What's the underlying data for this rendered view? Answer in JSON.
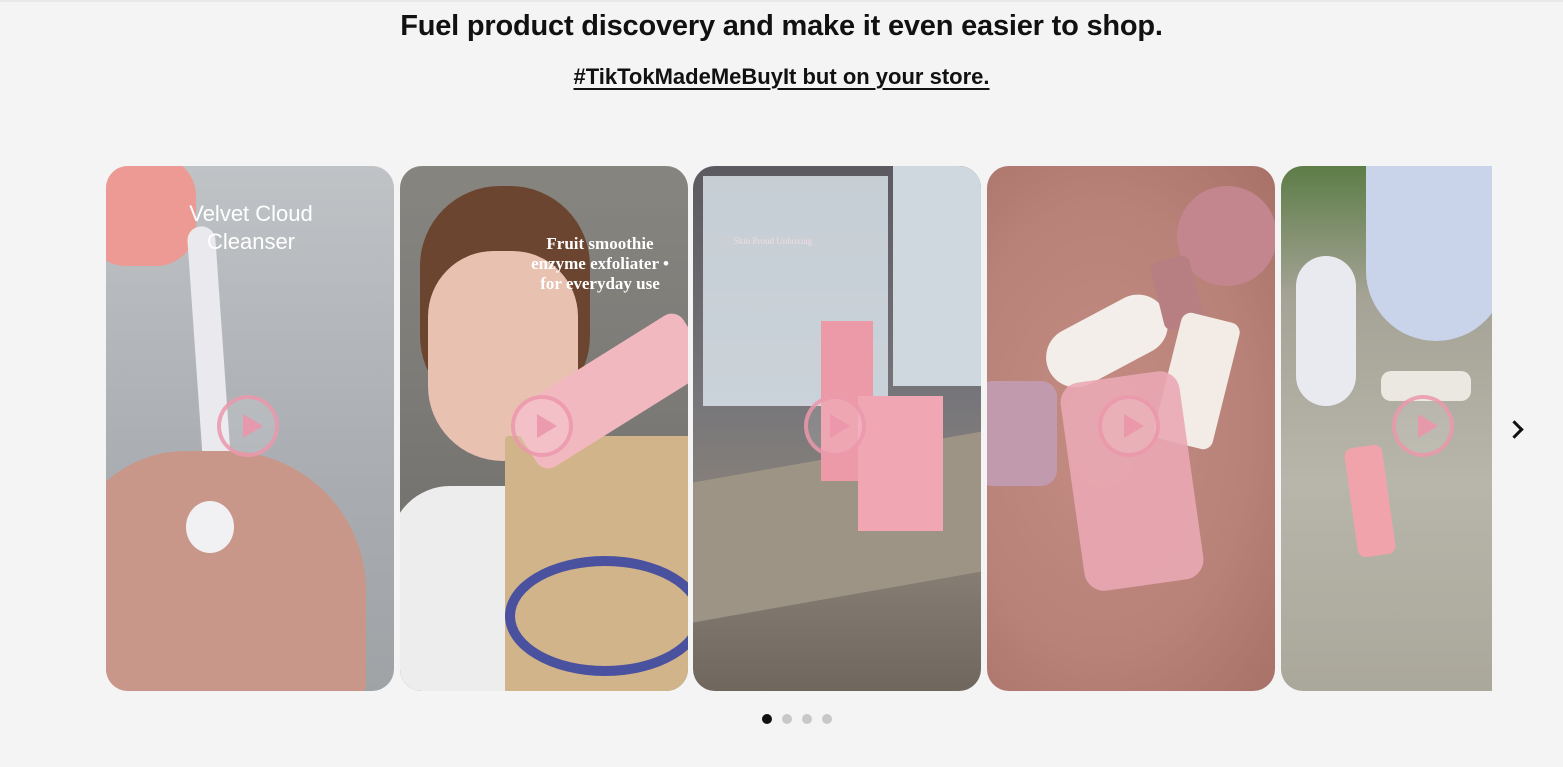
{
  "headline": "Fuel product discovery and make it even easier to shop.",
  "subline_link": "#TikTokMadeMeBuyIt but on your store. ",
  "carousel": {
    "cards": [
      {
        "overlay_text": "Velvet Cloud Cleanser"
      },
      {
        "overlay_text": "Fruit smoothie enzyme exfoliater • for everyday use"
      },
      {
        "overlay_text": "Skin Proud Unboxing"
      },
      {
        "overlay_text": ""
      },
      {
        "overlay_text": ""
      }
    ],
    "page_count": 4,
    "active_page": 1
  },
  "icons": {
    "play": "play-icon",
    "next": "chevron-right-icon"
  },
  "colors": {
    "background": "#f4f4f4",
    "text": "#111111",
    "play_ring": "#eb96aa",
    "dot_active": "#111111",
    "dot_inactive": "#c8c8c8"
  }
}
